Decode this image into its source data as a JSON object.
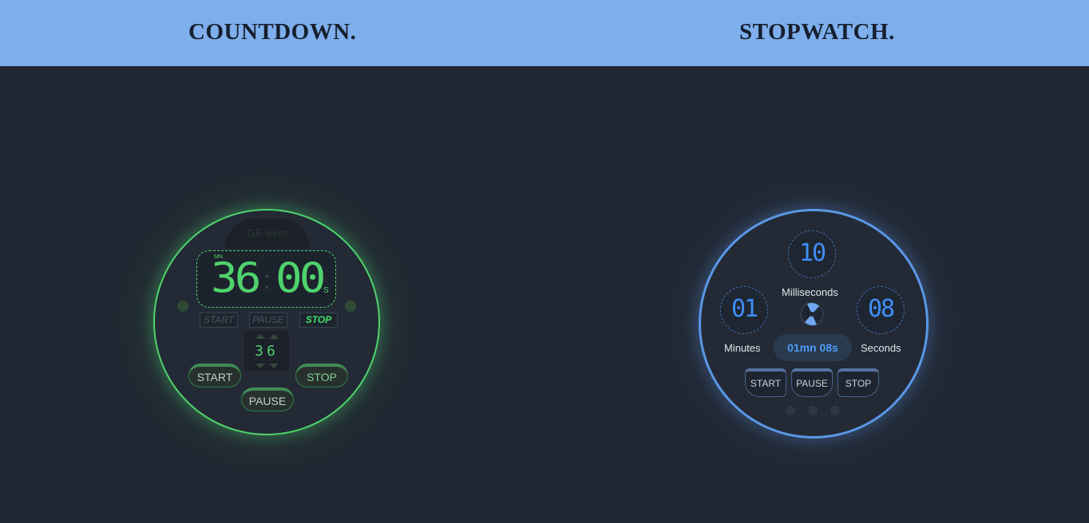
{
  "header": {
    "countdown_title": "COUNTDOWN.",
    "stopwatch_title": "STOPWATCH."
  },
  "colors": {
    "header_bg": "#7eaeec",
    "page_bg": "#222833",
    "countdown_accent": "#4fd36c",
    "stopwatch_accent": "#5a97e6"
  },
  "countdown": {
    "brand": "GF-ever",
    "unit_min": "MN",
    "minutes": "36",
    "colon": ":",
    "seconds": "00",
    "unit_sec": "S",
    "states": {
      "start": "START",
      "pause": "PAUSE",
      "stop": "STOP",
      "active": "stop"
    },
    "spinner_value": "36",
    "buttons": {
      "start": "START",
      "stop": "STOP",
      "pause": "PAUSE"
    }
  },
  "stopwatch": {
    "milliseconds": "10",
    "minutes": "01",
    "seconds": "08",
    "labels": {
      "milliseconds": "Milliseconds",
      "minutes": "Minutes",
      "seconds": "Seconds"
    },
    "summary": "01mn 08s",
    "buttons": {
      "start": "START",
      "pause": "PAUSE",
      "stop": "STOP"
    }
  }
}
